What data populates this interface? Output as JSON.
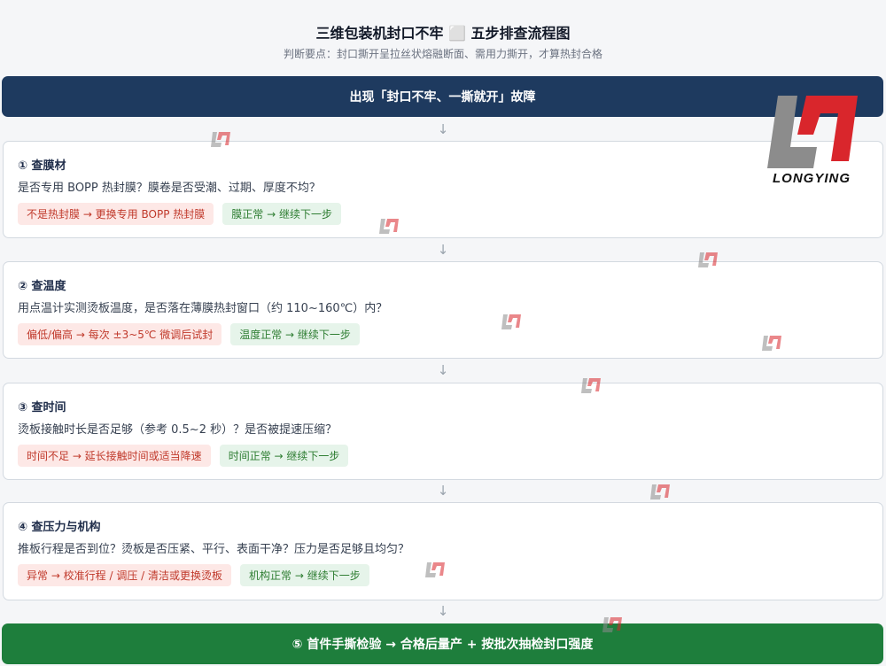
{
  "header": {
    "title": "三维包装机封口不牢 ⬜ 五步排查流程图",
    "subtitle": "判断要点：封口撕开呈拉丝状熔融断面、需用力撕开，才算热封合格"
  },
  "start": {
    "label": "出现「封口不牢、一撕就开」故障"
  },
  "arrow_glyph": "↓",
  "steps": [
    {
      "title": "① 查膜材",
      "question": "是否专用 BOPP 热封膜？膜卷是否受潮、过期、厚度不均？",
      "bad": "不是热封膜 → 更换专用 BOPP 热封膜",
      "good": "膜正常 → 继续下一步"
    },
    {
      "title": "② 查温度",
      "question": "用点温计实测烫板温度，是否落在薄膜热封窗口（约 110~160℃）内？",
      "bad": "偏低/偏高 → 每次 ±3~5℃ 微调后试封",
      "good": "温度正常 → 继续下一步"
    },
    {
      "title": "③ 查时间",
      "question": "烫板接触时长是否足够（参考 0.5~2 秒）？是否被提速压缩？",
      "bad": "时间不足 → 延长接触时间或适当降速",
      "good": "时间正常 → 继续下一步"
    },
    {
      "title": "④ 查压力与机构",
      "question": "推板行程是否到位？烫板是否压紧、平行、表面干净？压力是否足够且均匀？",
      "bad": "异常 → 校准行程 / 调压 / 清洁或更换烫板",
      "good": "机构正常 → 继续下一步"
    }
  ],
  "end": {
    "label": "⑤ 首件手撕检验 → 合格后量产 + 按批次抽检封口强度"
  },
  "logo": {
    "text": "LONGYING",
    "icon": "longying-logo-icon",
    "colors": {
      "grey": "#8c8c8c",
      "red": "#d9262c"
    }
  },
  "colors": {
    "start_bg": "#1e3a5f",
    "end_bg": "#1e7e3c",
    "bad_bg": "#fde8e6",
    "bad_text": "#c0392b",
    "good_bg": "#e6f4ea",
    "good_text": "#2e7d32"
  }
}
